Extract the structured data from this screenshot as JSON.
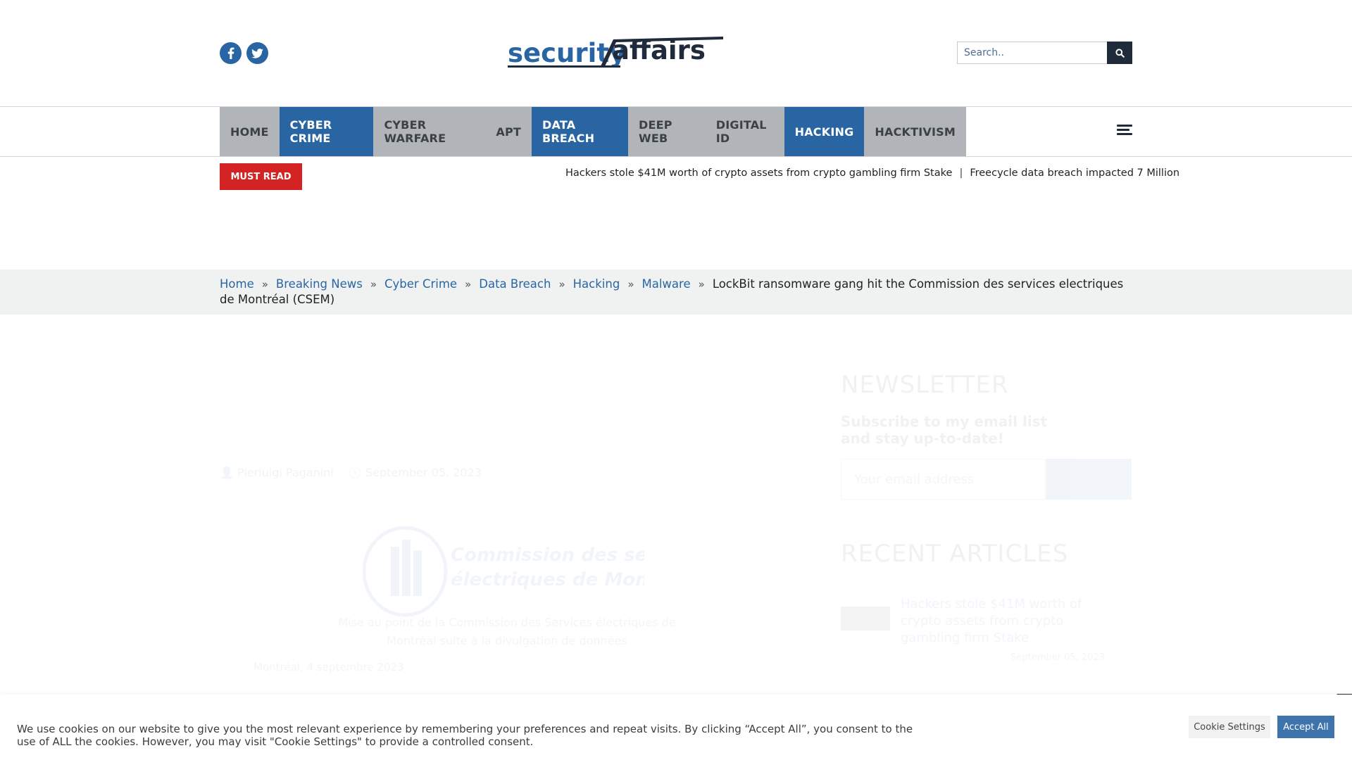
{
  "header": {
    "social": [
      {
        "name": "facebook",
        "glyph": "f"
      },
      {
        "name": "twitter",
        "glyph": "t"
      }
    ],
    "logo": {
      "part1": "security",
      "part2": "affairs"
    },
    "search": {
      "placeholder": "Search..",
      "button_icon": "search-icon"
    }
  },
  "nav": {
    "items": [
      {
        "label": "HOME",
        "active": false
      },
      {
        "label": "CYBER CRIME",
        "active": true
      },
      {
        "label": "CYBER WARFARE",
        "active": false
      },
      {
        "label": "APT",
        "active": false
      },
      {
        "label": "DATA BREACH",
        "active": true
      },
      {
        "label": "DEEP WEB",
        "active": false
      },
      {
        "label": "DIGITAL ID",
        "active": false
      },
      {
        "label": "HACKING",
        "active": true
      },
      {
        "label": "HACKTIVISM",
        "active": false
      }
    ],
    "menu_icon": "hamburger-menu-icon"
  },
  "must_read": {
    "label": "MUST READ",
    "ticker": [
      "Hackers stole $41M worth of crypto assets from crypto gambling firm Stake",
      "Freecycle data breach impacted 7 Million"
    ],
    "separator": "|"
  },
  "breadcrumb": {
    "items": [
      "Home",
      "Breaking News",
      "Cyber Crime",
      "Data Breach",
      "Hacking",
      "Malware"
    ],
    "separator": "»",
    "current": "LockBit ransomware gang hit the Commission des services electriques de Montréal (CSEM)"
  },
  "article": {
    "author": "Pierluigi Paganini",
    "date": "September 05, 2023",
    "logo_text_line1": "Commission des services",
    "logo_text_line2": "électriques de Montréal",
    "caption": "Mise au point de la Commission des Services électriques de Montréal suite à la divulgation de données",
    "body_date": "Montréal, 4 septembre 2023"
  },
  "sidebar": {
    "newsletter_title": "NEWSLETTER",
    "newsletter_sub": "Subscribe to my email list and stay up-to-date!",
    "email_placeholder": "Your email address",
    "recent_title": "RECENT ARTICLES",
    "recent": [
      {
        "title": "Hackers stole $41M worth of crypto assets from crypto gambling firm Stake",
        "date": "September 05, 2023"
      }
    ]
  },
  "cookie": {
    "text": "We use cookies on our website to give you the most relevant experience by remembering your preferences and repeat visits. By clicking “Accept All”, you consent to the use of ALL the cookies. However, you may visit \"Cookie Settings\" to provide a controlled consent.",
    "settings_label": "Cookie Settings",
    "accept_label": "Accept All",
    "close_glyph": "✕"
  },
  "colors": {
    "brand_blue": "#2a65a3",
    "nav_gray": "#b1b4b8",
    "must_read_red": "#d42323",
    "search_button": "#1f2a3a",
    "breadcrumb_bg": "#f0f2f2"
  }
}
